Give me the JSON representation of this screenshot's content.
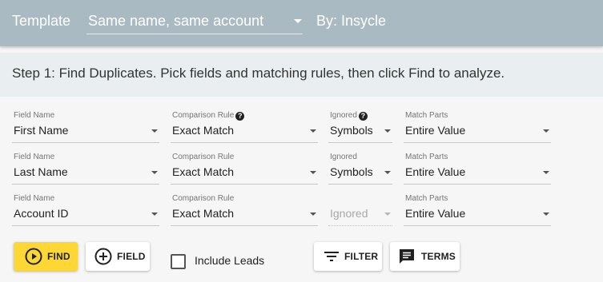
{
  "header": {
    "template_label": "Template",
    "template_value": "Same name, same account",
    "by_text": "By: Insycle"
  },
  "step": {
    "text": "Step 1: Find Duplicates. Pick fields and matching rules, then click Find to analyze."
  },
  "rules": [
    {
      "field_label": "Field Name",
      "field_value": "First Name",
      "comparison_label": "Comparison Rule",
      "comparison_value": "Exact Match",
      "ignored_label": "Ignored",
      "ignored_value": "Symbols",
      "match_label": "Match Parts",
      "match_value": "Entire Value"
    },
    {
      "field_label": "Field Name",
      "field_value": "Last Name",
      "comparison_label": "Comparison Rule",
      "comparison_value": "Exact Match",
      "ignored_label": "Ignored",
      "ignored_value": "Symbols",
      "match_label": "Match Parts",
      "match_value": "Entire Value"
    },
    {
      "field_label": "Field Name",
      "field_value": "Account ID",
      "comparison_label": "Comparison Rule",
      "comparison_value": "Exact Match",
      "ignored_label": "",
      "ignored_value": "Ignored",
      "match_label": "Match Parts",
      "match_value": "Entire Value"
    }
  ],
  "help_icon_glyph": "?",
  "actions": {
    "find_label": "FIND",
    "field_label": "FIELD",
    "include_leads_label": "Include Leads",
    "include_leads_checked": false,
    "filter_label": "FILTER",
    "terms_label": "TERMS"
  },
  "icons": {
    "find": "play-circle-icon",
    "field": "add-circle-icon",
    "filter": "filter-list-icon",
    "terms": "comment-icon",
    "help": "help-icon"
  },
  "colors": {
    "header_bg": "#a9bac3",
    "step_bg": "#e9eef1",
    "primary_button": "#fdd835"
  }
}
